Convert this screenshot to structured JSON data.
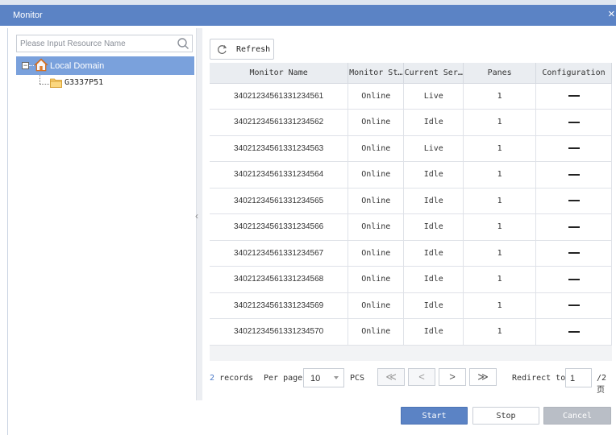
{
  "window": {
    "title": "Monitor",
    "close_glyph": "×"
  },
  "sidebar": {
    "search_placeholder": "Please Input Resource Name",
    "tree": {
      "root_label": "Local Domain",
      "root_toggle": "−",
      "children": [
        {
          "label": "G3337P51"
        }
      ]
    }
  },
  "toolbar": {
    "refresh_label": "Refresh"
  },
  "table": {
    "columns": [
      "Monitor Name",
      "Monitor St…",
      "Current Ser…",
      "Panes",
      "Configuration"
    ],
    "rows": [
      {
        "name": "340212345613312345​61",
        "status": "Online",
        "service": "Live",
        "panes": "1"
      },
      {
        "name": "34021234561331234562",
        "status": "Online",
        "service": "Idle",
        "panes": "1"
      },
      {
        "name": "34021234561331234563",
        "status": "Online",
        "service": "Live",
        "panes": "1"
      },
      {
        "name": "34021234561331234564",
        "status": "Online",
        "service": "Idle",
        "panes": "1"
      },
      {
        "name": "34021234561331234565",
        "status": "Online",
        "service": "Idle",
        "panes": "1"
      },
      {
        "name": "34021234561331234566",
        "status": "Online",
        "service": "Idle",
        "panes": "1"
      },
      {
        "name": "34021234561331234567",
        "status": "Online",
        "service": "Idle",
        "panes": "1"
      },
      {
        "name": "34021234561331234568",
        "status": "Online",
        "service": "Idle",
        "panes": "1"
      },
      {
        "name": "34021234561331234569",
        "status": "Online",
        "service": "Idle",
        "panes": "1"
      },
      {
        "name": "34021234561331234570",
        "status": "Online",
        "service": "Idle",
        "panes": "1"
      }
    ]
  },
  "pager": {
    "record_count": "2",
    "records_label": "records",
    "per_page_label": "Per page",
    "per_page_value": "10",
    "pcs_label": "PCS",
    "first_glyph": "≪",
    "prev_glyph": "<",
    "next_glyph": ">",
    "last_glyph": "≫",
    "redirect_label": "Redirect to",
    "page_value": "1",
    "total_pages": "/2 页"
  },
  "actions": {
    "start_label": "Start",
    "stop_label": "Stop",
    "cancel_label": "Cancel"
  },
  "colors": {
    "titlebar": "#5b83c5",
    "selected_tree": "#7aa1dc",
    "primary_button": "#5b83c5",
    "disabled_button": "#b9bec6"
  }
}
